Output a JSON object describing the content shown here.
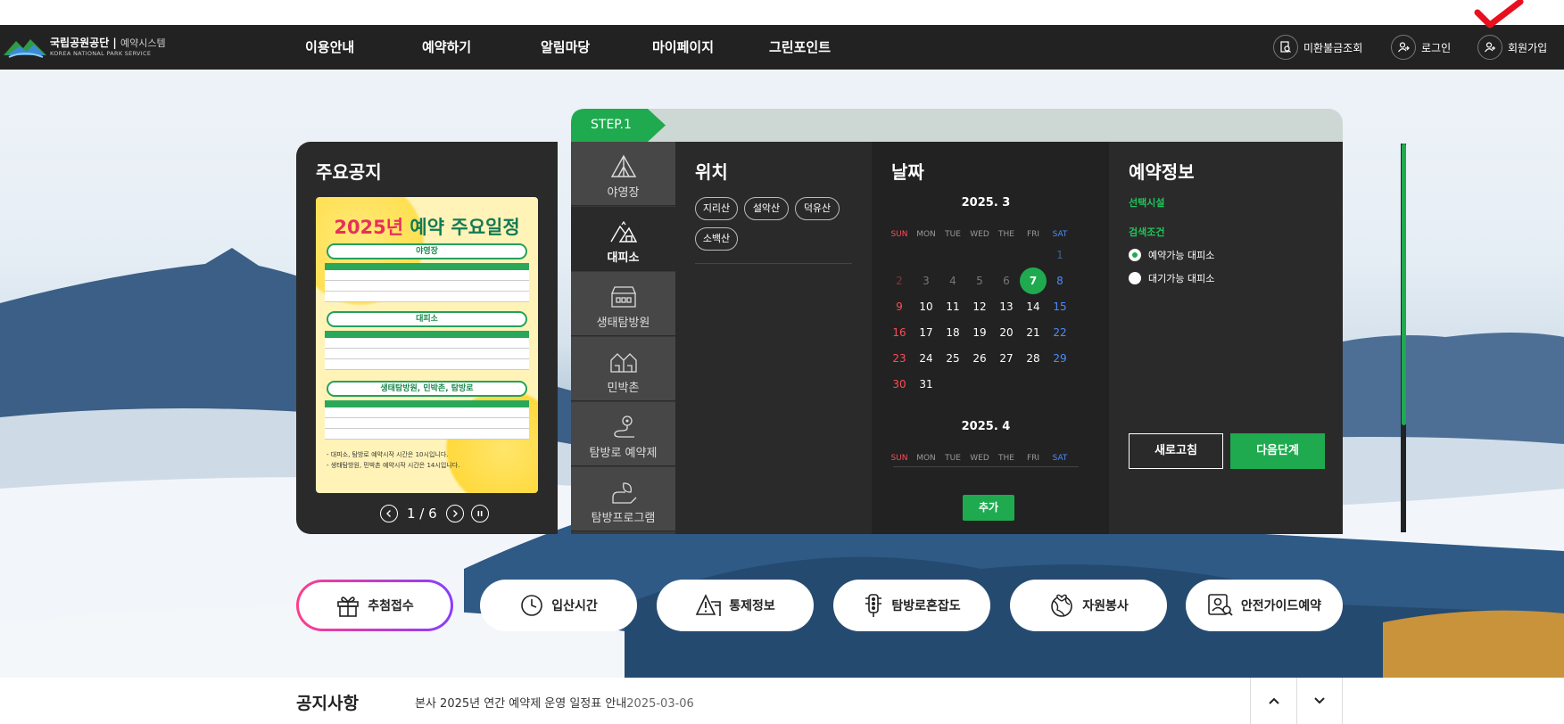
{
  "brand": {
    "name": "국립공원공단",
    "system": "예약시스템",
    "sub": "KOREA NATIONAL PARK SERVICE"
  },
  "nav": [
    "이용안내",
    "예약하기",
    "알림마당",
    "마이페이지",
    "그린포인트"
  ],
  "utility": {
    "unpaid": "미환불금조회",
    "login": "로그인",
    "signup": "회원가입"
  },
  "notice_panel": {
    "title": "주요공지",
    "poster": {
      "title_year": "2025년",
      "title_main": "예약 주요일정",
      "sections": [
        "야영장",
        "대피소",
        "생태탐방원, 민박촌, 탐방로"
      ],
      "notes": [
        "- 대피소, 탐방로 예약시작 시간은 10시입니다.",
        "- 생태탐방원, 민박촌 예약시작 시간은 14시입니다."
      ]
    },
    "pager": "1 / 6"
  },
  "step": {
    "label": "STEP.1"
  },
  "categories": [
    "야영장",
    "대피소",
    "생태탐방원",
    "민박촌",
    "탐방로 예약제",
    "탐방프로그램"
  ],
  "location": {
    "title": "위치",
    "chips": [
      "지리산",
      "설악산",
      "덕유산",
      "소백산"
    ]
  },
  "date": {
    "title": "날짜",
    "dow": [
      "SUN",
      "MON",
      "TUE",
      "WED",
      "THE",
      "FRI",
      "SAT"
    ],
    "month1": "2025. 3",
    "month2": "2025. 4",
    "selected_day": 7,
    "add": "추가"
  },
  "info": {
    "title": "예약정보",
    "facility_label": "선택시설",
    "condition_label": "검색조건",
    "options": [
      "예약가능 대피소",
      "대기가능 대피소"
    ],
    "selected_option": 0,
    "reset": "새로고침",
    "next": "다음단계"
  },
  "quick_links": [
    "추첨접수",
    "입산시간",
    "통제정보",
    "탐방로혼잡도",
    "자원봉사",
    "안전가이드예약"
  ],
  "notice_bar": {
    "title": "공지사항",
    "text": "본사 2025년 연간 예약제 운영 일정표 안내",
    "date": "2025-03-06"
  },
  "colors": {
    "accent": "#1faa4f",
    "nav_bg": "#222222",
    "panel_bg": "#2a2a2a"
  }
}
